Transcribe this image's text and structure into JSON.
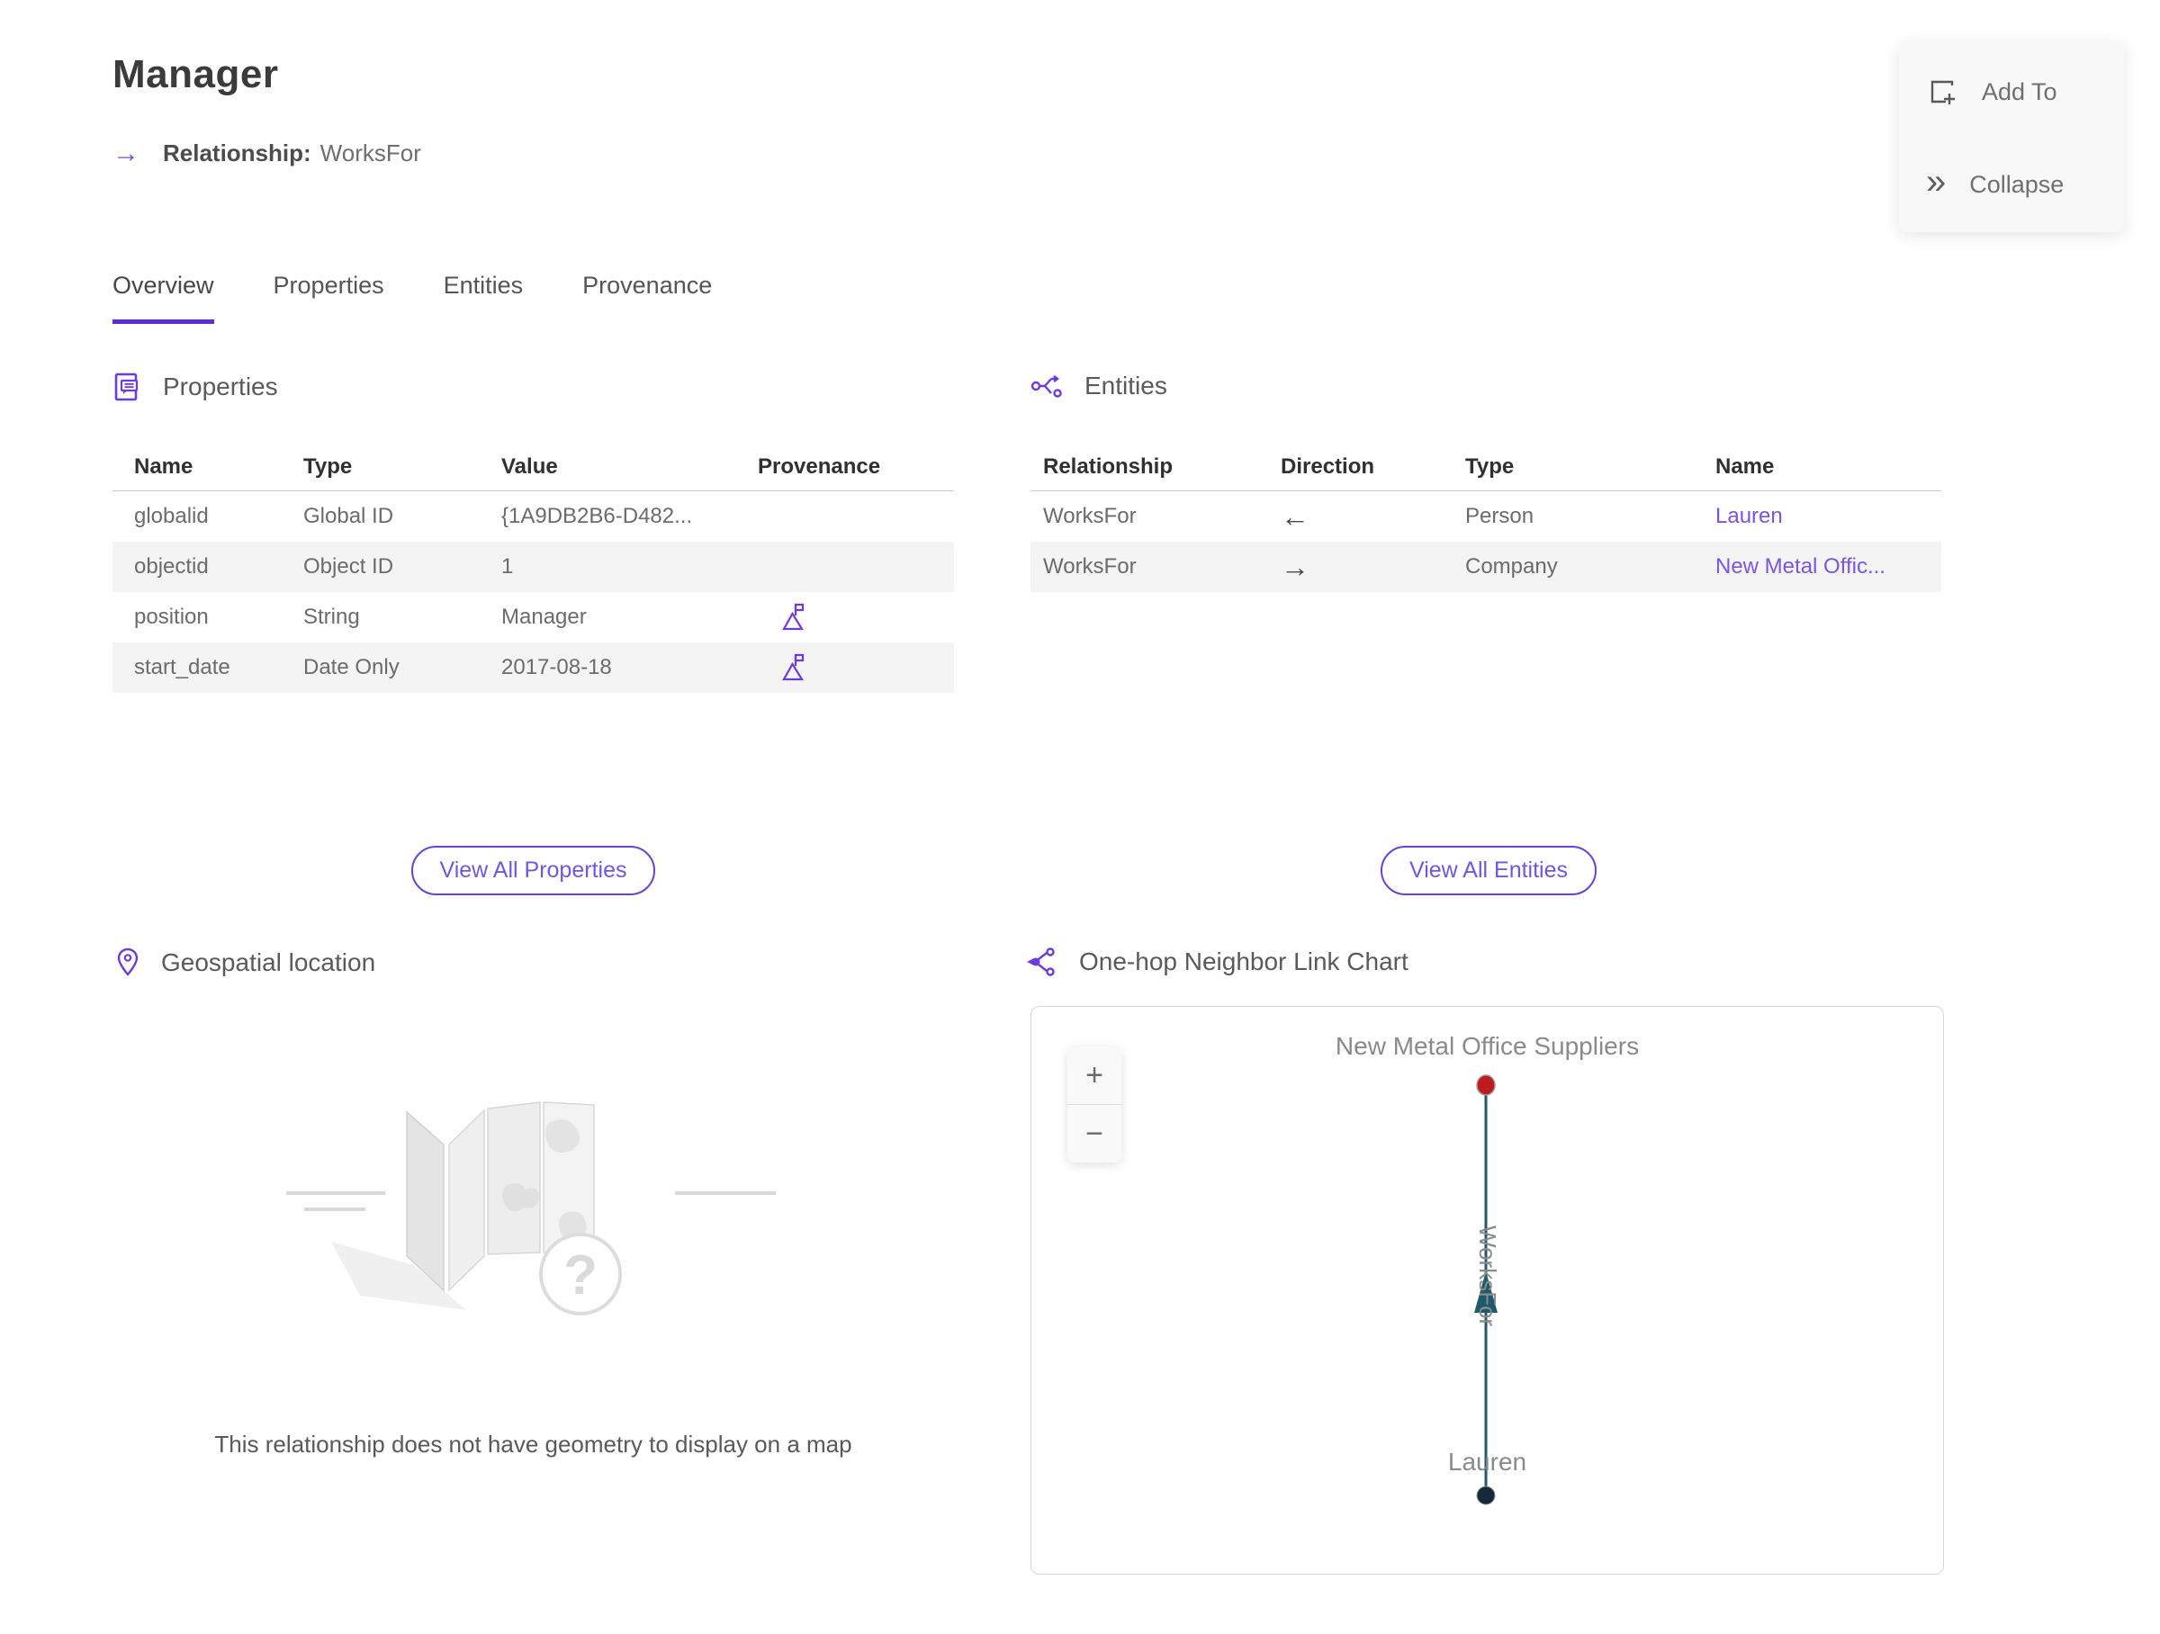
{
  "page": {
    "title": "Manager",
    "subtitle_label": "Relationship:",
    "subtitle_value": "WorksFor"
  },
  "icons": {
    "relationship_arrow": "→",
    "collapse_chevrons": "»"
  },
  "actions": {
    "add_to_label": "Add To",
    "collapse_label": "Collapse"
  },
  "tabs": [
    {
      "label": "Overview",
      "active": true
    },
    {
      "label": "Properties",
      "active": false
    },
    {
      "label": "Entities",
      "active": false
    },
    {
      "label": "Provenance",
      "active": false
    }
  ],
  "properties_section": {
    "title": "Properties",
    "columns": {
      "name": "Name",
      "type": "Type",
      "value": "Value",
      "provenance": "Provenance"
    },
    "rows": [
      {
        "name": "globalid",
        "type": "Global ID",
        "value": "{1A9DB2B6-D482...",
        "provenance_flag": false
      },
      {
        "name": "objectid",
        "type": "Object ID",
        "value": "1",
        "provenance_flag": false
      },
      {
        "name": "position",
        "type": "String",
        "value": "Manager",
        "provenance_flag": true
      },
      {
        "name": "start_date",
        "type": "Date Only",
        "value": "2017-08-18",
        "provenance_flag": true
      }
    ],
    "view_all_label": "View All Properties"
  },
  "entities_section": {
    "title": "Entities",
    "columns": {
      "relationship": "Relationship",
      "direction": "Direction",
      "type": "Type",
      "name": "Name"
    },
    "rows": [
      {
        "relationship": "WorksFor",
        "direction": "←",
        "type": "Person",
        "name": "Lauren"
      },
      {
        "relationship": "WorksFor",
        "direction": "→",
        "type": "Company",
        "name": "New Metal Offic..."
      }
    ],
    "view_all_label": "View All Entities"
  },
  "geospatial_section": {
    "title": "Geospatial location",
    "placeholder_glyph": "?",
    "empty_message": "This relationship does not have geometry to display on a map"
  },
  "link_chart_section": {
    "title": "One-hop Neighbor Link Chart",
    "zoom_in": "+",
    "zoom_out": "−",
    "top_node_label": "New Metal Office Suppliers",
    "bottom_node_label": "Lauren",
    "edge_label": "WorksFor",
    "top_node_color": "#bf1a1c",
    "bottom_node_color": "#16293a",
    "edge_color": "#1d5a6b"
  },
  "colors": {
    "accent_purple": "#5c2dd1",
    "icon_purple": "#6d3bdb",
    "link_purple": "#7a55e0",
    "row_alt": "#f4f4f4",
    "node_red": "#bf1a1c",
    "node_navy": "#16293a",
    "edge_teal": "#1d5a6b"
  }
}
